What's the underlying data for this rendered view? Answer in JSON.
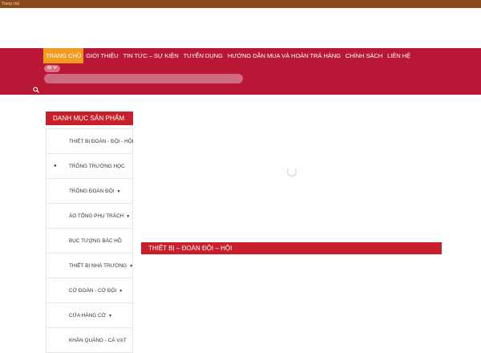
{
  "topbar": {
    "text": "Trang chủ"
  },
  "nav": {
    "items": [
      {
        "label": "TRANG CHỦ",
        "active": true
      },
      {
        "label": "GIỚI THIỆU",
        "active": false
      },
      {
        "label": "TIN TỨC – SỰ KIỆN",
        "active": false
      },
      {
        "label": "TUYỂN DỤNG",
        "active": false
      },
      {
        "label": "HƯỚNG DẪN MUA VÀ HOÀN TRẢ HÀNG",
        "active": false
      },
      {
        "label": "CHÍNH SÁCH",
        "active": false
      },
      {
        "label": "LIÊN HỆ",
        "active": false
      }
    ]
  },
  "search": {
    "category": "All",
    "query": "",
    "placeholder": ""
  },
  "sidebar": {
    "title": "DANH MỤC SẢN PHẨM",
    "items": [
      {
        "label": "THIẾT BỊ ĐOÀN - ĐỘI - HỘI",
        "bullet": false,
        "caret": false
      },
      {
        "label": "TRỐNG TRƯỜNG HỌC",
        "bullet": true,
        "caret": false
      },
      {
        "label": "TRỐNG ĐOÀN ĐỘI",
        "bullet": false,
        "caret": true
      },
      {
        "label": "ÁO TỔNG PHỤ TRÁCH",
        "bullet": false,
        "caret": true
      },
      {
        "label": "BỤC TƯỢNG BÁC HỒ",
        "bullet": false,
        "caret": false
      },
      {
        "label": "THIẾT BỊ NHÀ TRƯỜNG",
        "bullet": false,
        "caret": true
      },
      {
        "label": "CỜ ĐOÀN - CỜ ĐỘI",
        "bullet": false,
        "caret": true
      },
      {
        "label": "CỬA HÀNG CỜ",
        "bullet": false,
        "caret": true
      },
      {
        "label": "KHĂN QUÀNG - CÀ VẠT",
        "bullet": false,
        "caret": false
      }
    ]
  },
  "main": {
    "section_title": "THIẾT BỊ – ĐOÀN ĐỘI – HỘI"
  },
  "colors": {
    "topbar": "#8a4a1c",
    "nav_band": "#b81736",
    "active_nav": "#f29c1f",
    "section_red": "#c81f2a"
  }
}
